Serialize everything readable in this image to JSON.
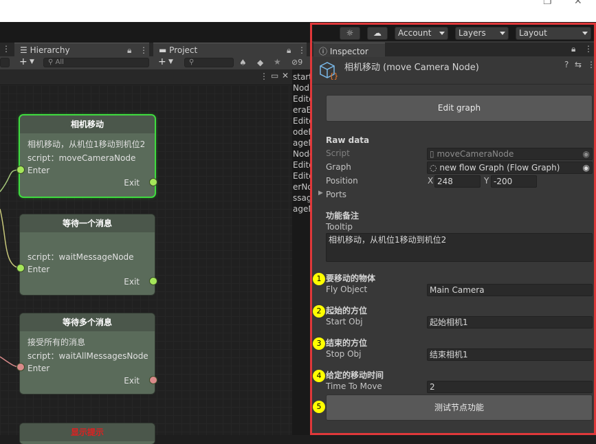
{
  "left_panels": {
    "hierarchy_tab": "Hierarchy",
    "project_tab": "Project",
    "hierarchy_search_placeholder": "All",
    "add_label": "+",
    "project_count": "9"
  },
  "nodes": [
    {
      "title": "相机移动",
      "description": "相机移动，从机位1移动到机位2",
      "script": "script：moveCameraNode",
      "enter": "Enter",
      "exit": "Exit"
    },
    {
      "title": "等待一个消息",
      "description": "",
      "script": "script：waitMessageNode",
      "enter": "Enter",
      "exit": "Exit"
    },
    {
      "title": "等待多个消息",
      "description": "接受所有的消息",
      "script": "script：waitAllMessagesNode",
      "enter": "Enter",
      "exit": "Exit"
    },
    {
      "title": "显示提示"
    }
  ],
  "cutoff_lines": [
    "startU",
    "Nod",
    "Edito",
    "eraE",
    "Editor",
    "odeE",
    "ageM",
    "Node",
    "Edito",
    "Edito",
    "erNo",
    "ssag",
    "ageN"
  ],
  "toolbar": {
    "account": "Account",
    "layers": "Layers",
    "layout": "Layout"
  },
  "inspector": {
    "tab_label": "Inspector",
    "title": "相机移动 (move Camera Node)",
    "edit_graph": "Edit graph",
    "raw_data": "Raw data",
    "script_label": "Script",
    "script_value": "moveCameraNode",
    "graph_label": "Graph",
    "graph_value": "new flow Graph (Flow Graph)",
    "position_label": "Position",
    "pos_x_label": "X",
    "pos_x": "248",
    "pos_y_label": "Y",
    "pos_y": "-200",
    "ports_label": "Ports",
    "notes_header": "功能备注",
    "tooltip_label": "Tooltip",
    "tooltip_value": "相机移动，从机位1移动到机位2",
    "fly_header": "要移动的物体",
    "fly_label": "Fly Object",
    "fly_value": "Main Camera",
    "start_header": "起始的方位",
    "start_label": "Start Obj",
    "start_value": "起始相机1",
    "stop_header": "结束的方位",
    "stop_label": "Stop Obj",
    "stop_value": "结束相机1",
    "time_header": "给定的移动时间",
    "time_label": "Time To Move",
    "time_value": "2",
    "test_button": "测试节点功能"
  },
  "markers": [
    "1",
    "2",
    "3",
    "4",
    "5"
  ],
  "colors": {
    "highlight_border": "#e0383a",
    "marker": "#ffff00",
    "active_node_glow": "#3fdc3f"
  }
}
